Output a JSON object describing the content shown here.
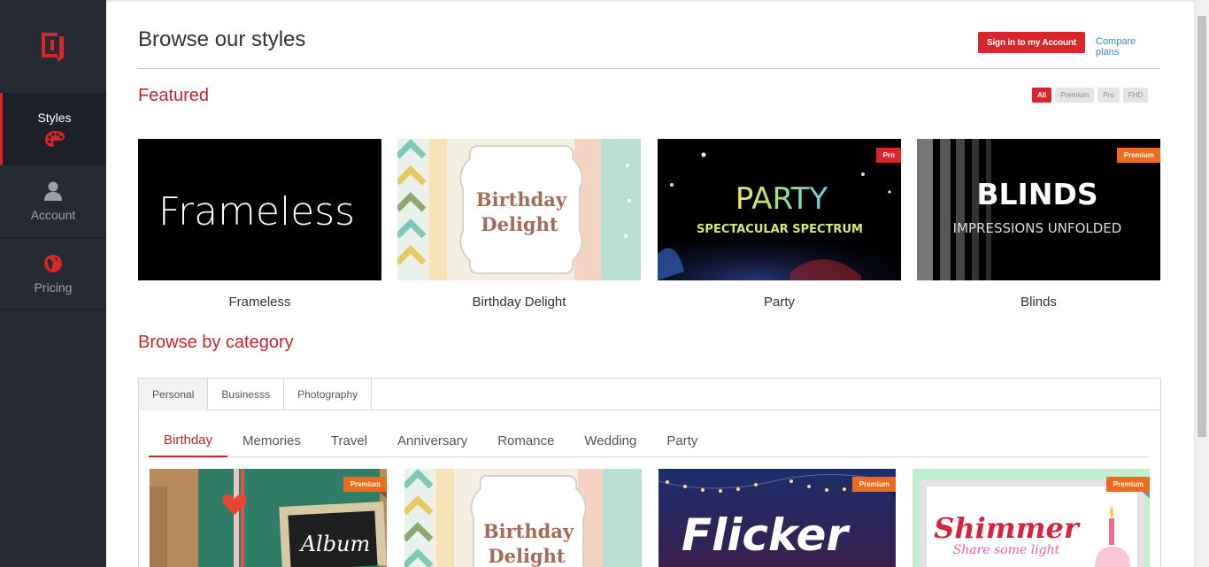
{
  "sidebar": {
    "logo_icon": "app-logo-icon",
    "items": [
      {
        "label": "Styles",
        "icon": "palette-icon",
        "active": true
      },
      {
        "label": "Account",
        "icon": "user-icon",
        "active": false
      },
      {
        "label": "Pricing",
        "icon": "globe-icon",
        "active": false
      }
    ]
  },
  "header": {
    "title": "Browse our styles",
    "signin_label": "Sign in to my Account",
    "compare_label": "Compare plans"
  },
  "featured": {
    "title": "Featured",
    "filters": [
      "All",
      "Premium",
      "Pro",
      "FHD"
    ],
    "active_filter": "All",
    "cards": [
      {
        "name": "Frameless",
        "thumb_text": "Frameless",
        "badge": ""
      },
      {
        "name": "Birthday Delight",
        "thumb_text": "Birthday Delight",
        "badge": ""
      },
      {
        "name": "Party",
        "thumb_text": "PARTY",
        "thumb_sub": "SPECTACULAR SPECTRUM",
        "badge": "Pro"
      },
      {
        "name": "Blinds",
        "thumb_text": "BLINDS",
        "thumb_sub": "IMPRESSIONS UNFOLDED",
        "badge": "Premium"
      }
    ]
  },
  "browse": {
    "title": "Browse by category",
    "category_tabs": [
      "Personal",
      "Businesss",
      "Photography"
    ],
    "active_category": "Personal",
    "sub_tabs": [
      "Birthday",
      "Memories",
      "Travel",
      "Anniversary",
      "Romance",
      "Wedding",
      "Party"
    ],
    "active_sub_tab": "Birthday",
    "cards": [
      {
        "thumb_text": "Album",
        "badge": "Premium"
      },
      {
        "thumb_text": "Birthday Delight",
        "badge": ""
      },
      {
        "thumb_text": "Flicker",
        "badge": "Premium"
      },
      {
        "thumb_text": "Shimmer",
        "thumb_sub": "Share some light",
        "badge": "Premium"
      }
    ]
  },
  "colors": {
    "accent": "#d9262c",
    "premium": "#ef6a1a",
    "sidebar_bg": "#262a33",
    "link": "#3a87c4"
  }
}
